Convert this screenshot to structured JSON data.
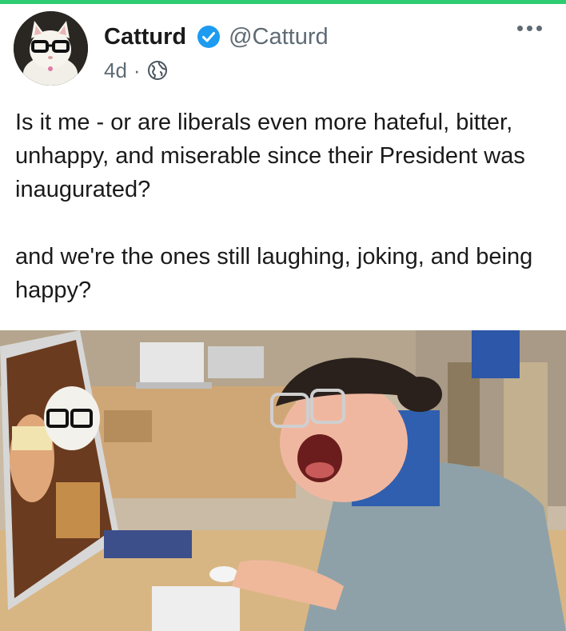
{
  "post": {
    "author": {
      "display_name": "Catturd",
      "handle": "@Catturd",
      "verified_icon": "verified-badge-icon",
      "avatar_icon": "cat-with-glasses-avatar"
    },
    "meta": {
      "age": "4d",
      "separator": "·",
      "visibility_icon": "globe-icon"
    },
    "text": {
      "paragraph_1": "Is it me - or are liberals even more hateful, bitter, unhappy, and miserable since their President was inaugurated?",
      "paragraph_2": "and we're the ones still laughing, joking, and being happy?"
    },
    "more_icon": "more-horizontal-icon"
  },
  "colors": {
    "accent_bar": "#2ecc71",
    "verified_blue": "#1d9bf0",
    "text_primary": "#1a1a1a",
    "text_secondary": "#5f6b74"
  }
}
